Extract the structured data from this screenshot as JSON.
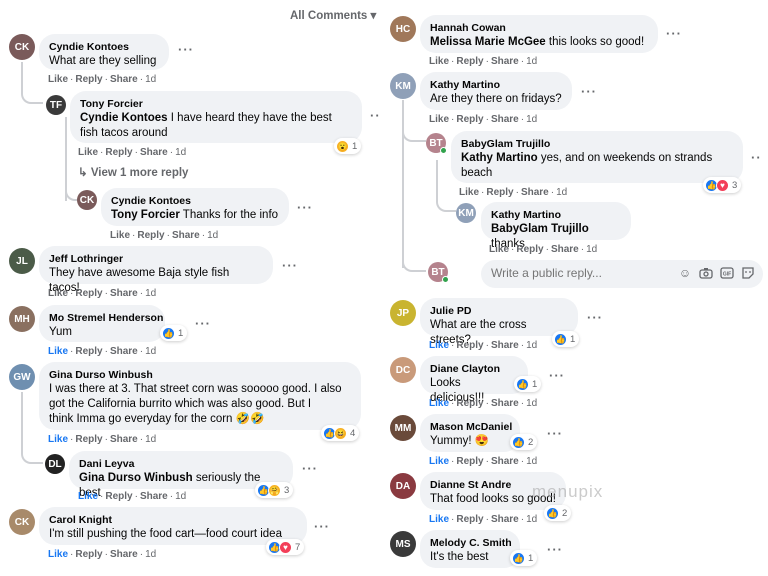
{
  "header": {
    "all_comments": "All Comments"
  },
  "left": {
    "c1": {
      "name": "Cyndie Kontoes",
      "text": "What are they selling",
      "like": "Like",
      "reply": "Reply",
      "share": "Share",
      "time": "1d"
    },
    "c1r1": {
      "name": "Tony Forcier",
      "tag": "Cyndie Kontoes",
      "text1": " I have heard they have the best",
      "text2": "fish tacos around",
      "like": "Like",
      "reply": "Reply",
      "share": "Share",
      "time": "1d",
      "react_count": "1"
    },
    "c1more": {
      "label": "View 1 more reply"
    },
    "c1r2": {
      "name": "Cyndie Kontoes",
      "tag": "Tony Forcier",
      "text": " Thanks for the info",
      "like": "Like",
      "reply": "Reply",
      "share": "Share",
      "time": "1d"
    },
    "c2": {
      "name": "Jeff Lothringer",
      "text": "They have awesome Baja style fish tacos!",
      "like": "Like",
      "reply": "Reply",
      "share": "Share",
      "time": "1d"
    },
    "c3": {
      "name": "Mo Stremel Henderson",
      "text": "Yum",
      "like": "Like",
      "reply": "Reply",
      "share": "Share",
      "time": "1d",
      "react_count": "1"
    },
    "c4": {
      "name": "Gina Durso Winbush",
      "line1": "I was there at 3. That street corn was sooooo good. I also",
      "line2": "got the California burrito which was also good. But I",
      "line3": "think Imma go everyday for the corn 🤣🤣",
      "like": "Like",
      "reply": "Reply",
      "share": "Share",
      "time": "1d",
      "react_count": "4"
    },
    "c4r1": {
      "name": "Dani Leyva",
      "tag": "Gina Durso Winbush",
      "text": " seriously the best",
      "like": "Like",
      "reply": "Reply",
      "share": "Share",
      "time": "1d",
      "react_count": "3"
    },
    "c5": {
      "name": "Carol Knight",
      "text": "I'm still pushing the food cart—food court idea",
      "like": "Like",
      "reply": "Reply",
      "share": "Share",
      "time": "1d",
      "react_count": "7"
    }
  },
  "right": {
    "c1": {
      "name": "Hannah Cowan",
      "tag": "Melissa Marie McGee",
      "text": " this looks so good!",
      "like": "Like",
      "reply": "Reply",
      "share": "Share",
      "time": "1d"
    },
    "c2": {
      "name": "Kathy Martino",
      "text": "Are they there on fridays?",
      "like": "Like",
      "reply": "Reply",
      "share": "Share",
      "time": "1d"
    },
    "c2r1": {
      "name": "BabyGlam Trujillo",
      "tag": "Kathy Martino",
      "text1": " yes, and on weekends on strands",
      "text2": "beach",
      "like": "Like",
      "reply": "Reply",
      "share": "Share",
      "time": "1d",
      "react_count": "3"
    },
    "c2r2": {
      "name": "Kathy Martino",
      "tag": "BabyGlam Trujillo",
      "text": " thanks",
      "like": "Like",
      "reply": "Reply",
      "share": "Share",
      "time": "1d"
    },
    "reply_box": {
      "placeholder": "Write a public reply..."
    },
    "c3": {
      "name": "Julie PD",
      "text": "What are the cross streets?",
      "like": "Like",
      "reply": "Reply",
      "share": "Share",
      "time": "1d",
      "react_count": "1"
    },
    "c4": {
      "name": "Diane Clayton",
      "text": "Looks delicious!!!",
      "like": "Like",
      "reply": "Reply",
      "share": "Share",
      "time": "1d",
      "react_count": "1"
    },
    "c5": {
      "name": "Mason McDaniel",
      "text": "Yummy! 😍",
      "like": "Like",
      "reply": "Reply",
      "share": "Share",
      "time": "1d",
      "react_count": "2"
    },
    "c6": {
      "name": "Dianne St Andre",
      "text": "That food looks so good!",
      "like": "Like",
      "reply": "Reply",
      "share": "Share",
      "time": "1d",
      "react_count": "2"
    },
    "c7": {
      "name": "Melody C. Smith",
      "text": "It's the best",
      "react_count": "1"
    }
  },
  "watermark": "menupix",
  "colors": {
    "bubble": "#f0f2f5",
    "meta": "#65676b",
    "like_blue": "#1877f2",
    "love_red": "#f33e58",
    "haha_yellow": "#f7b125"
  }
}
